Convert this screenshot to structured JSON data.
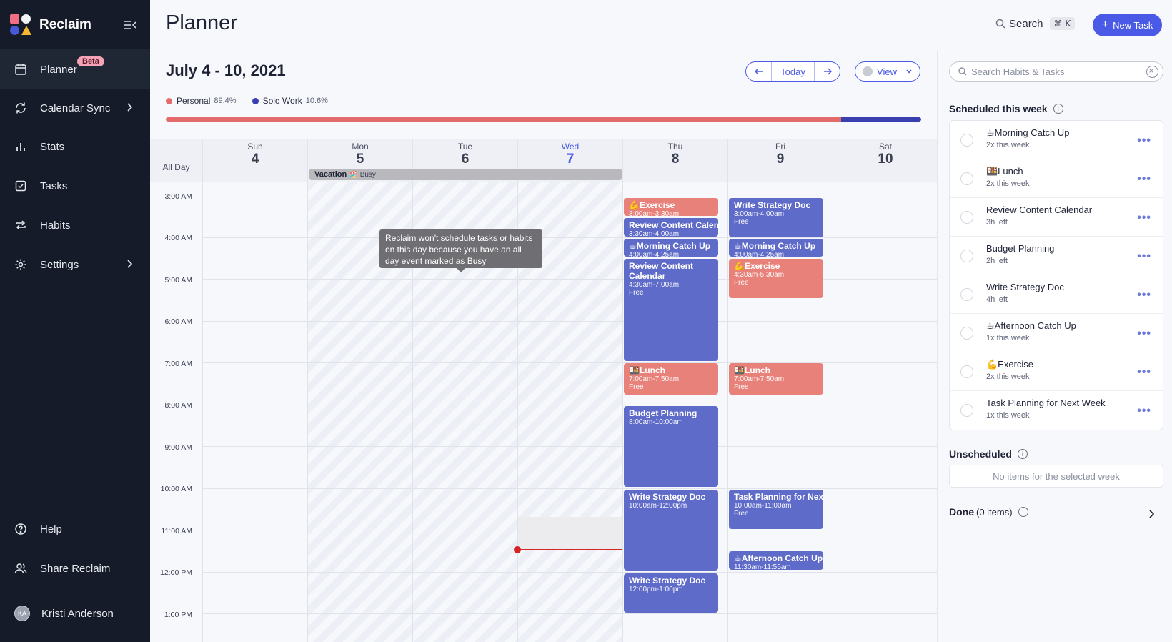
{
  "app": {
    "name": "Reclaim"
  },
  "sidebar": {
    "items": [
      {
        "label": "Planner",
        "badge": "Beta"
      },
      {
        "label": "Calendar Sync"
      },
      {
        "label": "Stats"
      },
      {
        "label": "Tasks"
      },
      {
        "label": "Habits"
      },
      {
        "label": "Settings"
      }
    ],
    "bottom": [
      {
        "label": "Help"
      },
      {
        "label": "Share Reclaim"
      },
      {
        "label": "Kristi Anderson",
        "initials": "KA"
      }
    ]
  },
  "header": {
    "title": "Planner",
    "search_label": "Search",
    "shortcut": "⌘ K",
    "new_task": "New Task"
  },
  "planner": {
    "week_title": "July 4 - 10, 2021",
    "today_label": "Today",
    "view_label": "View",
    "legend": [
      {
        "name": "Personal",
        "pct": "89.4%",
        "color": "#e46b6b",
        "value": 89.4
      },
      {
        "name": "Solo Work",
        "pct": "10.6%",
        "color": "#3a3fb0",
        "value": 10.6
      }
    ],
    "allday_label": "All Day",
    "days": [
      {
        "name": "Sun",
        "date": "4"
      },
      {
        "name": "Mon",
        "date": "5"
      },
      {
        "name": "Tue",
        "date": "6"
      },
      {
        "name": "Wed",
        "date": "7",
        "today": true
      },
      {
        "name": "Thu",
        "date": "8"
      },
      {
        "name": "Fri",
        "date": "9"
      },
      {
        "name": "Sat",
        "date": "10"
      }
    ],
    "vacation": {
      "title": "Vacation",
      "emoji": "🏖️",
      "status": "Busy"
    },
    "times": [
      "3:00 AM",
      "4:00 AM",
      "5:00 AM",
      "6:00 AM",
      "7:00 AM",
      "8:00 AM",
      "9:00 AM",
      "10:00 AM",
      "11:00 AM",
      "12:00 PM",
      "1:00 PM"
    ],
    "tooltip": "Reclaim won't schedule tasks or habits on this day because you have an all day event marked as Busy",
    "events": {
      "thu_exercise": {
        "title": "💪Exercise",
        "time": "3:00am-3:30am"
      },
      "thu_review": {
        "title": "Review Content Calendar",
        "time": "3:30am-4:00am"
      },
      "thu_morning": {
        "title": "☕Morning Catch Up",
        "time": "4:00am-4:25am"
      },
      "thu_review2": {
        "title": "Review Content Calendar",
        "time": "4:30am-7:00am",
        "free": "Free"
      },
      "thu_lunch": {
        "title": "🍱Lunch",
        "time": "7:00am-7:50am",
        "free": "Free"
      },
      "thu_budget": {
        "title": "Budget Planning",
        "time": "8:00am-10:00am"
      },
      "thu_strategy": {
        "title": "Write Strategy Doc",
        "time": "10:00am-12:00pm"
      },
      "thu_strategy2": {
        "title": "Write Strategy Doc",
        "time": "12:00pm-1:00pm"
      },
      "fri_strategy": {
        "title": "Write Strategy Doc",
        "time": "3:00am-4:00am",
        "free": "Free"
      },
      "fri_morning": {
        "title": "☕Morning Catch Up",
        "time": "4:00am-4:25am"
      },
      "fri_exercise": {
        "title": "💪Exercise",
        "time": "4:30am-5:30am",
        "free": "Free"
      },
      "fri_lunch": {
        "title": "🍱Lunch",
        "time": "7:00am-7:50am",
        "free": "Free"
      },
      "fri_taskplan": {
        "title": "Task Planning for Next Week",
        "time": "10:00am-11:00am",
        "free": "Free"
      },
      "fri_afternoon": {
        "title": "☕Afternoon Catch Up",
        "time": "11:30am-11:55am"
      }
    }
  },
  "panel": {
    "search_placeholder": "Search Habits & Tasks",
    "scheduled_title": "Scheduled this week",
    "tasks": [
      {
        "title": "☕Morning Catch Up",
        "sub": "2x this week"
      },
      {
        "title": "🍱Lunch",
        "sub": "2x this week"
      },
      {
        "title": "Review Content Calendar",
        "sub": "3h left"
      },
      {
        "title": "Budget Planning",
        "sub": "2h left"
      },
      {
        "title": "Write Strategy Doc",
        "sub": "4h left"
      },
      {
        "title": "☕Afternoon Catch Up",
        "sub": "1x this week"
      },
      {
        "title": "💪Exercise",
        "sub": "2x this week"
      },
      {
        "title": "Task Planning for Next Week",
        "sub": "1x this week"
      }
    ],
    "unscheduled_title": "Unscheduled",
    "unscheduled_empty": "No items for the selected week",
    "done_title": "Done",
    "done_count": "(0 items)"
  }
}
